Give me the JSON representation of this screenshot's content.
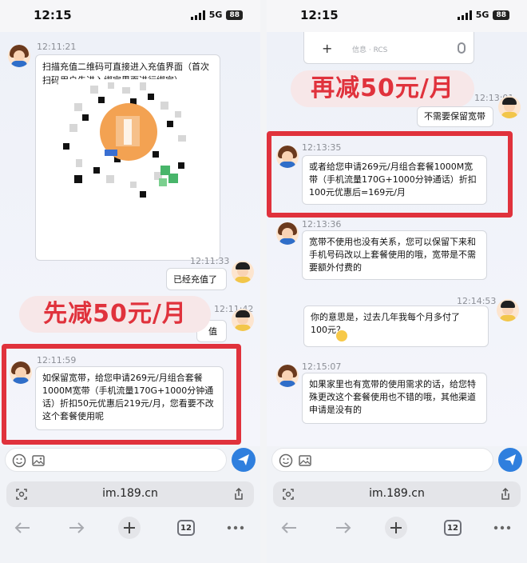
{
  "left": {
    "status": {
      "time": "12:15",
      "network": "5G",
      "battery": "88"
    },
    "messages": {
      "m1": {
        "time": "12:11:21",
        "text": "扫描充值二维码可直接进入充值界面（首次扫码用户先进入绑定界面进行绑定）。"
      },
      "m2": {
        "time": "12:11:33",
        "text": "已经充值了"
      },
      "m3": {
        "time": "12:11:42",
        "text": "值"
      },
      "m4": {
        "time": "12:11:59",
        "text": "如保留宽带，给您申请269元/月组合套餐1000M宽带（手机流量170G+1000分钟通话）折扣50元优惠后219元/月，您看要不改这个套餐使用呢"
      }
    },
    "promo": "先减50元/月",
    "url": "im.189.cn",
    "tabs_count": "12"
  },
  "right": {
    "status": {
      "time": "12:15",
      "network": "5G",
      "battery": "88"
    },
    "rcs_placeholder": "信息 · RCS",
    "messages": {
      "m0": {
        "time": "12:13:01",
        "text": "不需要保留宽带"
      },
      "m1": {
        "time": "12:13:35",
        "text": "或者给您申请269元/月组合套餐1000M宽带（手机流量170G+1000分钟通话）折扣100元优惠后=169元/月"
      },
      "m2": {
        "time": "12:13:36",
        "text": "宽带不使用也没有关系，您可以保留下来和手机号码改以上套餐使用的哦，宽带是不需要额外付费的"
      },
      "m3": {
        "time": "12:14:53",
        "text": "你的意思是，过去几年我每个月多付了100元？"
      },
      "m4": {
        "time": "12:15:07",
        "text": "如果家里也有宽带的使用需求的话，给您特殊更改这个套餐使用也不错的哦，其他渠道申请是没有的"
      }
    },
    "promo": "再减50元/月",
    "url": "im.189.cn",
    "tabs_count": "12"
  },
  "colors": {
    "highlight_red": "#e0323c",
    "send_blue": "#2f7fde"
  }
}
